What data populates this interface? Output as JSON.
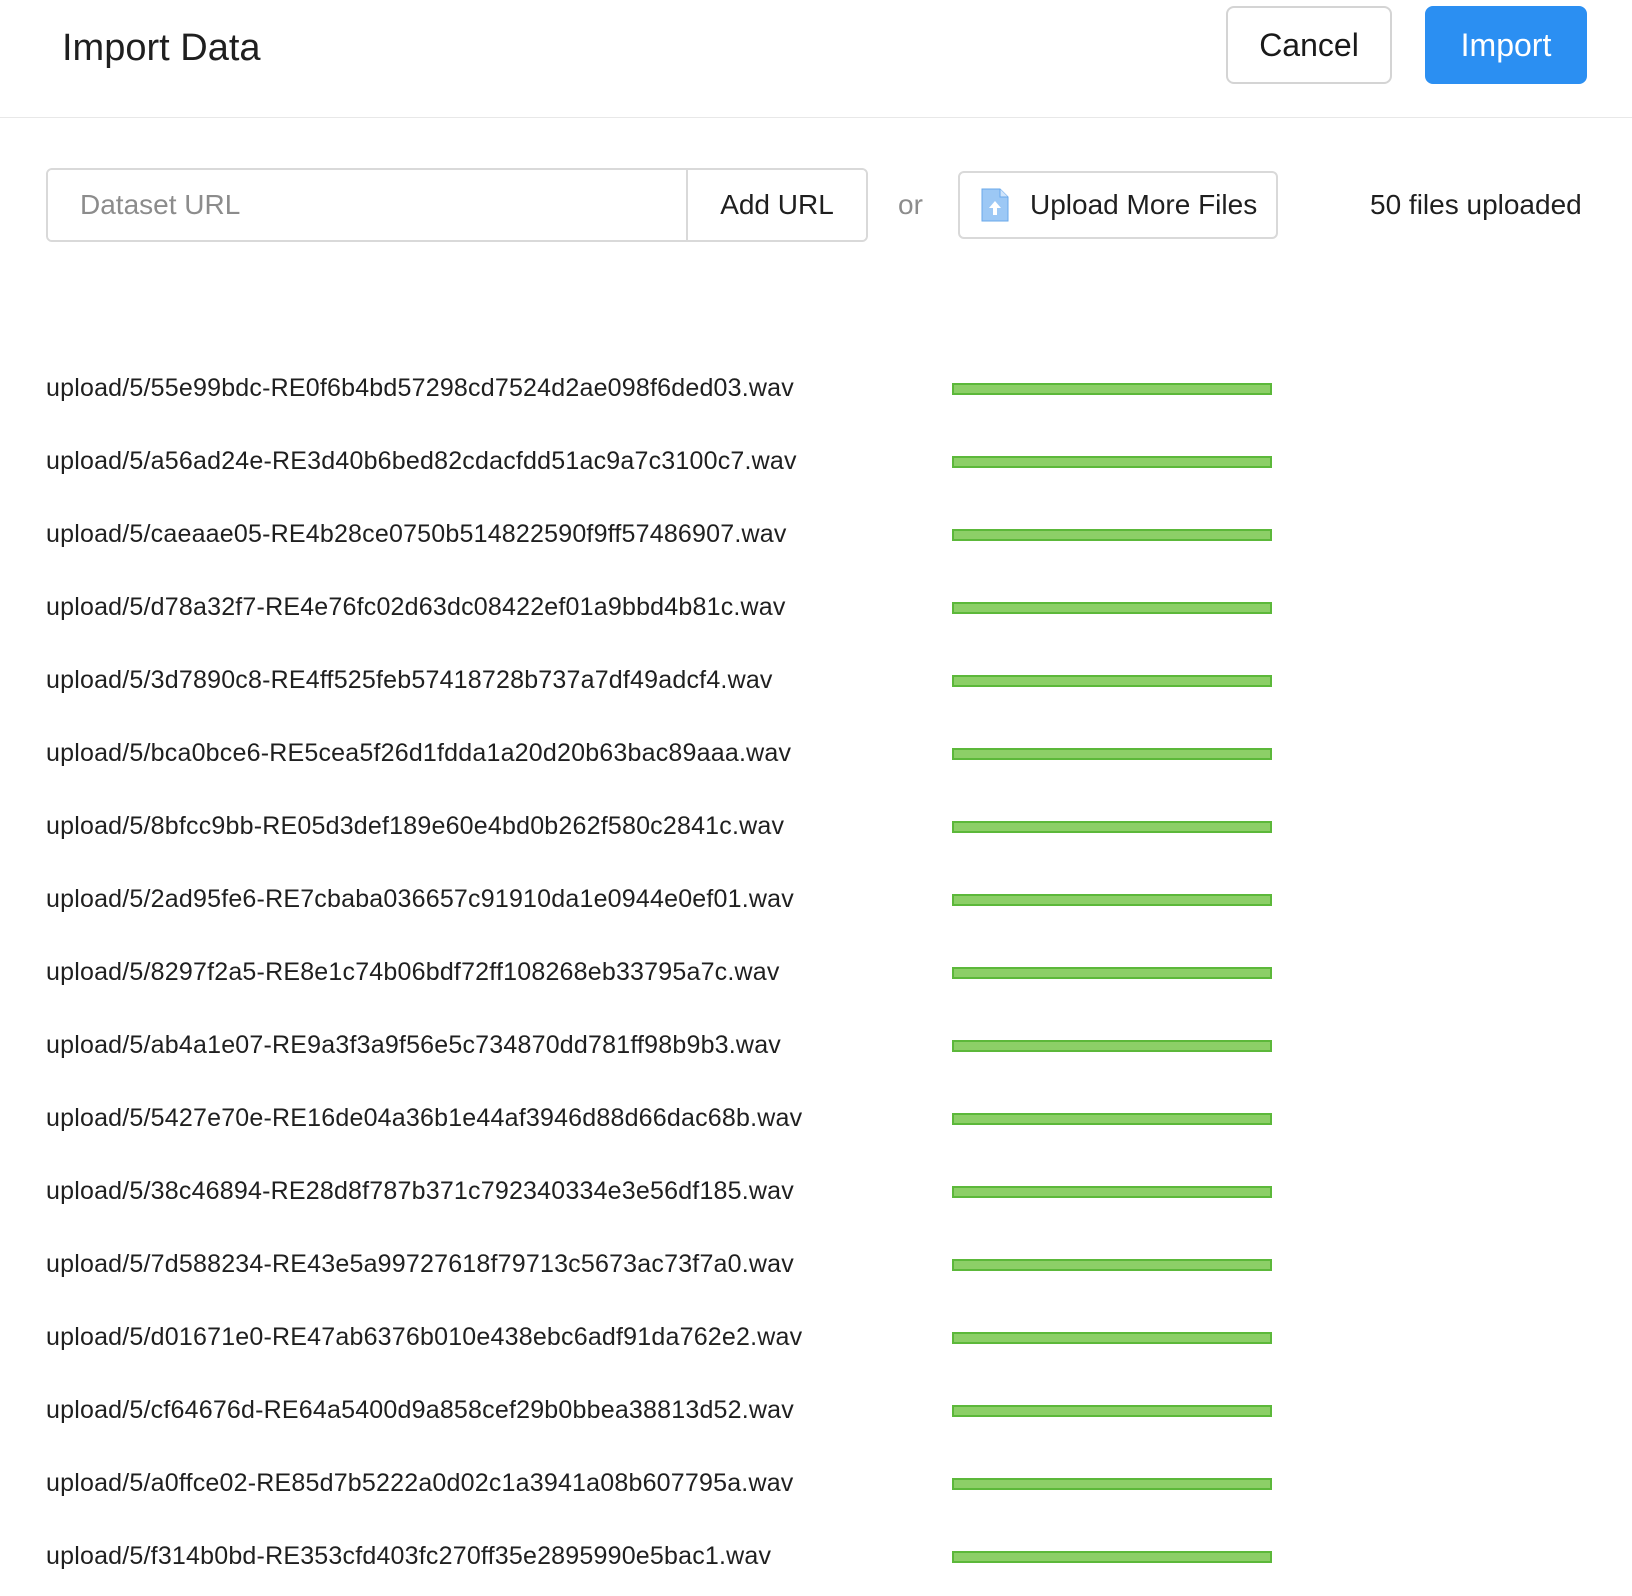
{
  "header": {
    "title": "Import Data",
    "cancel_label": "Cancel",
    "import_label": "Import"
  },
  "toolbar": {
    "url_placeholder": "Dataset URL",
    "url_value": "",
    "add_url_label": "Add URL",
    "or_text": "or",
    "upload_label": "Upload More Files",
    "upload_icon": "file-upload-icon",
    "files_count": "50 files uploaded"
  },
  "colors": {
    "primary": "#2b8ff2",
    "progress_fill": "#8ccf67",
    "progress_border": "#5cb83a"
  },
  "files": [
    {
      "name": "upload/5/55e99bdc-RE0f6b4bd57298cd7524d2ae098f6ded03.wav",
      "progress": 1.0
    },
    {
      "name": "upload/5/a56ad24e-RE3d40b6bed82cdacfdd51ac9a7c3100c7.wav",
      "progress": 1.0
    },
    {
      "name": "upload/5/caeaae05-RE4b28ce0750b514822590f9ff57486907.wav",
      "progress": 1.0
    },
    {
      "name": "upload/5/d78a32f7-RE4e76fc02d63dc08422ef01a9bbd4b81c.wav",
      "progress": 1.0
    },
    {
      "name": "upload/5/3d7890c8-RE4ff525feb57418728b737a7df49adcf4.wav",
      "progress": 1.0
    },
    {
      "name": "upload/5/bca0bce6-RE5cea5f26d1fdda1a20d20b63bac89aaa.wav",
      "progress": 1.0
    },
    {
      "name": "upload/5/8bfcc9bb-RE05d3def189e60e4bd0b262f580c2841c.wav",
      "progress": 1.0
    },
    {
      "name": "upload/5/2ad95fe6-RE7cbaba036657c91910da1e0944e0ef01.wav",
      "progress": 1.0
    },
    {
      "name": "upload/5/8297f2a5-RE8e1c74b06bdf72ff108268eb33795a7c.wav",
      "progress": 1.0
    },
    {
      "name": "upload/5/ab4a1e07-RE9a3f3a9f56e5c734870dd781ff98b9b3.wav",
      "progress": 1.0
    },
    {
      "name": "upload/5/5427e70e-RE16de04a36b1e44af3946d88d66dac68b.wav",
      "progress": 1.0
    },
    {
      "name": "upload/5/38c46894-RE28d8f787b371c792340334e3e56df185.wav",
      "progress": 1.0
    },
    {
      "name": "upload/5/7d588234-RE43e5a99727618f79713c5673ac73f7a0.wav",
      "progress": 1.0
    },
    {
      "name": "upload/5/d01671e0-RE47ab6376b010e438ebc6adf91da762e2.wav",
      "progress": 1.0
    },
    {
      "name": "upload/5/cf64676d-RE64a5400d9a858cef29b0bbea38813d52.wav",
      "progress": 1.0
    },
    {
      "name": "upload/5/a0ffce02-RE85d7b5222a0d02c1a3941a08b607795a.wav",
      "progress": 1.0
    },
    {
      "name": "upload/5/f314b0bd-RE353cfd403fc270ff35e2895990e5bac1.wav",
      "progress": 1.0
    }
  ]
}
